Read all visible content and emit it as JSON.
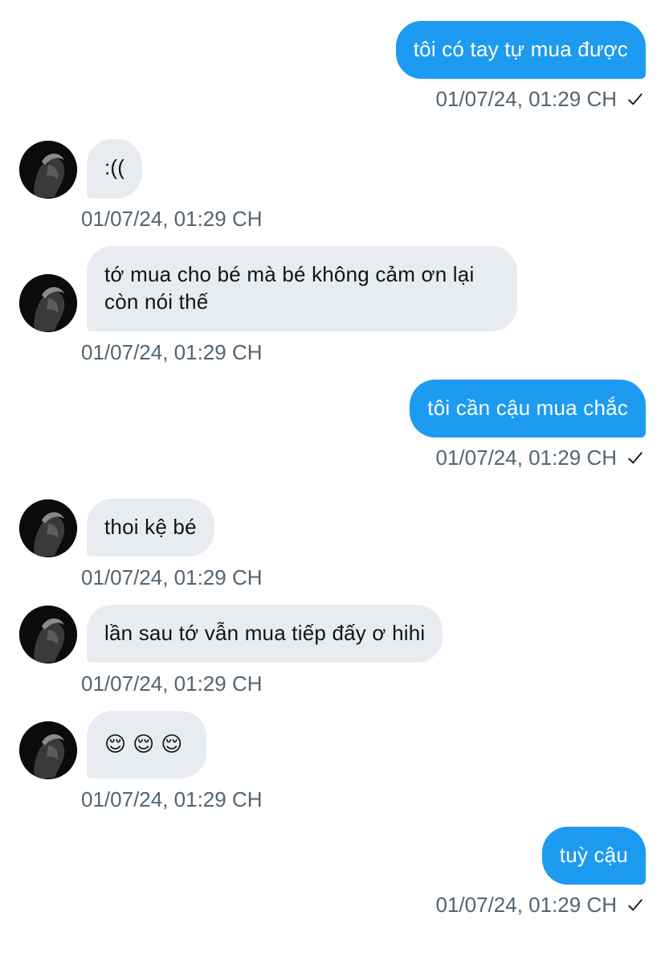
{
  "messages": [
    {
      "side": "out",
      "text": "tôi có tay tự mua được",
      "time": "01/07/24, 01:29 CH"
    },
    {
      "side": "in",
      "text": ":((",
      "time": "01/07/24, 01:29 CH"
    },
    {
      "side": "in",
      "text": "tớ mua cho bé mà bé không cảm ơn lại còn nói thế",
      "time": "01/07/24, 01:29 CH"
    },
    {
      "side": "out",
      "text": "tôi cần cậu mua chắc",
      "time": "01/07/24, 01:29 CH"
    },
    {
      "side": "in",
      "text": "thoi kệ bé",
      "time": "01/07/24, 01:29 CH"
    },
    {
      "side": "in",
      "text": "lần sau tớ vẫn mua tiếp đấy ơ hihi",
      "time": "01/07/24, 01:29 CH"
    },
    {
      "side": "in",
      "text": "😌😌😌",
      "time": "01/07/24, 01:29 CH"
    },
    {
      "side": "out",
      "text": "tuỳ cậu",
      "time": "01/07/24, 01:29 CH"
    }
  ],
  "colors": {
    "outgoing_bubble": "#1d9bf0",
    "incoming_bubble": "#e8ecf0",
    "timestamp": "#536471"
  },
  "icons": {
    "sent_status": "checkmark-icon",
    "sender_avatar": "avatar"
  }
}
